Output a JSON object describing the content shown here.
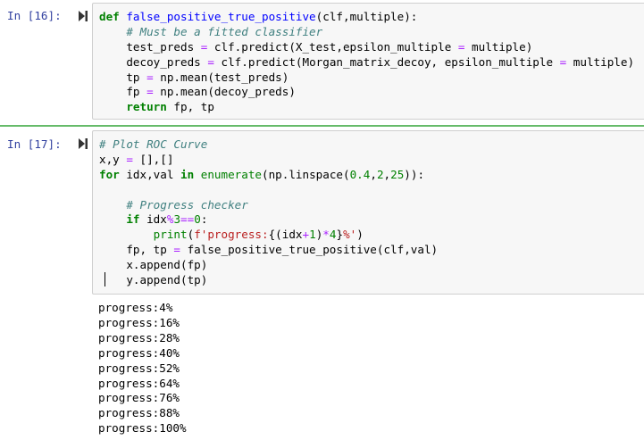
{
  "cells": [
    {
      "prompt": "In [16]:",
      "lines": [
        [
          [
            "def",
            "k"
          ],
          [
            " ",
            ""
          ],
          [
            "false_positive_true_positive",
            "f"
          ],
          [
            "(clf,multiple):",
            ""
          ]
        ],
        [
          [
            "    ",
            ""
          ],
          [
            "# Must be a fitted classifier",
            "c"
          ]
        ],
        [
          [
            "    test_preds ",
            ""
          ],
          [
            "=",
            "o"
          ],
          [
            " clf.predict(X_test,epsilon_multiple ",
            ""
          ],
          [
            "=",
            "o"
          ],
          [
            " multiple)",
            ""
          ]
        ],
        [
          [
            "    decoy_preds ",
            ""
          ],
          [
            "=",
            "o"
          ],
          [
            " clf.predict(Morgan_matrix_decoy, epsilon_multiple ",
            ""
          ],
          [
            "=",
            "o"
          ],
          [
            " multiple)",
            ""
          ]
        ],
        [
          [
            "    tp ",
            ""
          ],
          [
            "=",
            "o"
          ],
          [
            " np.mean(test_preds)",
            ""
          ]
        ],
        [
          [
            "    fp ",
            ""
          ],
          [
            "=",
            "o"
          ],
          [
            " np.mean(decoy_preds)",
            ""
          ]
        ],
        [
          [
            "    ",
            ""
          ],
          [
            "return",
            "k"
          ],
          [
            " fp, tp",
            ""
          ]
        ]
      ]
    },
    {
      "prompt": "In [17]:",
      "lines": [
        [
          [
            "# Plot ROC Curve",
            "c"
          ]
        ],
        [
          [
            "x,y ",
            ""
          ],
          [
            "=",
            "o"
          ],
          [
            " [],[]",
            ""
          ]
        ],
        [
          [
            "for",
            "k"
          ],
          [
            " idx,val ",
            ""
          ],
          [
            "in",
            "k"
          ],
          [
            " ",
            ""
          ],
          [
            "enumerate",
            "b"
          ],
          [
            "(np.linspace(",
            ""
          ],
          [
            "0.4",
            "n"
          ],
          [
            ",",
            ""
          ],
          [
            "2",
            "n"
          ],
          [
            ",",
            ""
          ],
          [
            "25",
            "n"
          ],
          [
            ")):",
            ""
          ]
        ],
        [],
        [
          [
            "    ",
            ""
          ],
          [
            "# Progress checker",
            "c"
          ]
        ],
        [
          [
            "    ",
            ""
          ],
          [
            "if",
            "k"
          ],
          [
            " idx",
            ""
          ],
          [
            "%",
            "o"
          ],
          [
            "3",
            "n"
          ],
          [
            "==",
            "o"
          ],
          [
            "0",
            "n"
          ],
          [
            ":",
            ""
          ]
        ],
        [
          [
            "        ",
            ""
          ],
          [
            "print",
            "b"
          ],
          [
            "(",
            ""
          ],
          [
            "f'progress:",
            "s"
          ],
          [
            "{(idx",
            ""
          ],
          [
            "+",
            "o"
          ],
          [
            "1",
            "n"
          ],
          [
            ")",
            ""
          ],
          [
            "*",
            "o"
          ],
          [
            "4",
            "n"
          ],
          [
            "}",
            ""
          ],
          [
            "%'",
            "s"
          ],
          [
            ")",
            ""
          ]
        ],
        [
          [
            "    fp, tp ",
            ""
          ],
          [
            "=",
            "o"
          ],
          [
            " false_positive_true_positive(clf,val)",
            ""
          ]
        ],
        [
          [
            "    x.append(fp)",
            ""
          ]
        ],
        [
          [
            "    y.append(tp)",
            ""
          ]
        ]
      ],
      "output": [
        "progress:4%",
        "progress:16%",
        "progress:28%",
        "progress:40%",
        "progress:52%",
        "progress:64%",
        "progress:76%",
        "progress:88%",
        "progress:100%"
      ]
    }
  ],
  "colors": {
    "prompt": "#303f9f",
    "selected_border": "#66bb6a"
  }
}
